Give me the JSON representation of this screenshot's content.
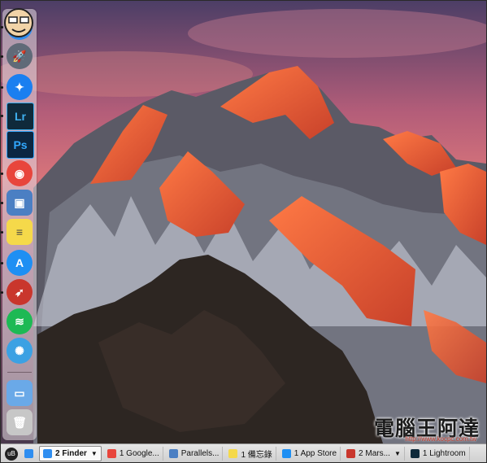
{
  "dock": {
    "items": [
      {
        "name": "finder",
        "glyph": "☺",
        "color": "#2f8ef0"
      },
      {
        "name": "launchpad",
        "glyph": "🚀",
        "color": "#606a78"
      },
      {
        "name": "safari",
        "glyph": "✦",
        "color": "#1a7ff0"
      },
      {
        "name": "lightroom",
        "glyph": "Lr",
        "color": "#0f2a3b"
      },
      {
        "name": "photoshop",
        "glyph": "Ps",
        "color": "#0c2741"
      },
      {
        "name": "chrome",
        "glyph": "◉",
        "color": "#e8453c"
      },
      {
        "name": "parallels",
        "glyph": "▣",
        "color": "#4b7fc3"
      },
      {
        "name": "notes",
        "glyph": "≡",
        "color": "#f5d94a"
      },
      {
        "name": "app-store",
        "glyph": "A",
        "color": "#1e8ff3"
      },
      {
        "name": "mars",
        "glyph": "➶",
        "color": "#c9362c"
      },
      {
        "name": "spotify",
        "glyph": "≋",
        "color": "#1db954"
      },
      {
        "name": "twitterrific",
        "glyph": "✺",
        "color": "#3ba1e3"
      },
      {
        "name": "downloads-folder",
        "glyph": "▭",
        "color": "#6aa9e8"
      },
      {
        "name": "trash",
        "glyph": "🗑",
        "color": "#c7c7c7"
      }
    ]
  },
  "taskbar": {
    "start_label": "uB",
    "items": [
      {
        "label": "2 Finder",
        "active": true,
        "color": "#2f8ef0"
      },
      {
        "label": "1 Google...",
        "active": false,
        "color": "#e8453c"
      },
      {
        "label": "Parallels...",
        "active": false,
        "color": "#4b7fc3"
      },
      {
        "label": "1 備忘錄",
        "active": false,
        "color": "#f5d94a"
      },
      {
        "label": "1 App Store",
        "active": false,
        "color": "#1e8ff3"
      },
      {
        "label": "2 Mars...",
        "active": false,
        "color": "#c9362c"
      },
      {
        "label": "1 Lightroom",
        "active": false,
        "color": "#0f2a3b"
      }
    ]
  },
  "watermark": {
    "text": "電腦王阿達",
    "url": "http://www.kocpc.com.tw"
  }
}
